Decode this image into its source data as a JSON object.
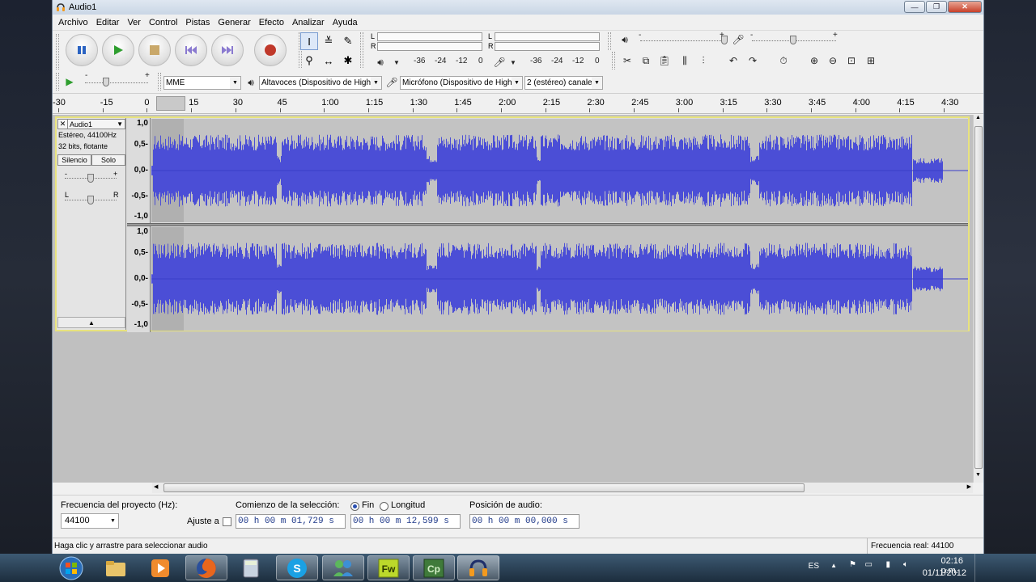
{
  "window": {
    "title": "Audio1"
  },
  "menu": [
    "Archivo",
    "Editar",
    "Ver",
    "Control",
    "Pistas",
    "Generar",
    "Efecto",
    "Analizar",
    "Ayuda"
  ],
  "meters": {
    "playback_scale": [
      "-36",
      "-24",
      "-12",
      "0"
    ],
    "record_scale": [
      "-36",
      "-24",
      "-12",
      "0"
    ],
    "l": "L",
    "r": "R"
  },
  "mixer": {
    "minus": "-",
    "plus": "+"
  },
  "device": {
    "host": "MME",
    "output": "Altavoces (Dispositivo de High",
    "input": "Micrófono (Dispositivo de High",
    "channels": "2 (estéreo) canale"
  },
  "ruler": [
    "-30",
    "-15",
    "0",
    "15",
    "30",
    "45",
    "1:00",
    "1:15",
    "1:30",
    "1:45",
    "2:00",
    "2:15",
    "2:30",
    "2:45",
    "3:00",
    "3:15",
    "3:30",
    "3:45",
    "4:00",
    "4:15",
    "4:30"
  ],
  "track": {
    "name": "Audio1",
    "close": "✕",
    "info1": "Estéreo, 44100Hz",
    "info2": "32 bits, flotante",
    "mute": "Silencio",
    "solo": "Solo",
    "gain_minus": "-",
    "gain_plus": "+",
    "pan_l": "L",
    "pan_r": "R",
    "scale": [
      "1,0",
      "0,5-",
      "0,0-",
      "-0,5-",
      "-1,0"
    ]
  },
  "selection_toolbar": {
    "rate_label": "Frecuencia del proyecto (Hz):",
    "rate_value": "44100",
    "snap_label": "Ajuste a",
    "start_label": "Comienzo de la selección:",
    "end_option": "Fin",
    "length_option": "Longitud",
    "start_value": "00 h 00 m 01,729 s",
    "end_value": "00 h 00 m 12,599 s",
    "position_label": "Posición de audio:",
    "position_value": "00 h 00 m 00,000 s"
  },
  "status": {
    "left": "Haga clic y arrastre para seleccionar audio",
    "right": "Frecuencia real: 44100"
  },
  "taskbar": {
    "lang": "ES",
    "time": "02:16 p.m.",
    "date": "01/11/2012",
    "apps": [
      "start",
      "explorer",
      "media-player",
      "firefox",
      "calculator",
      "skype",
      "messenger",
      "fireworks",
      "captivate",
      "audacity"
    ]
  },
  "colors": {
    "wave": "#4b4ed6",
    "track_border": "#e8e37d",
    "selection": "#b0b0b0"
  }
}
